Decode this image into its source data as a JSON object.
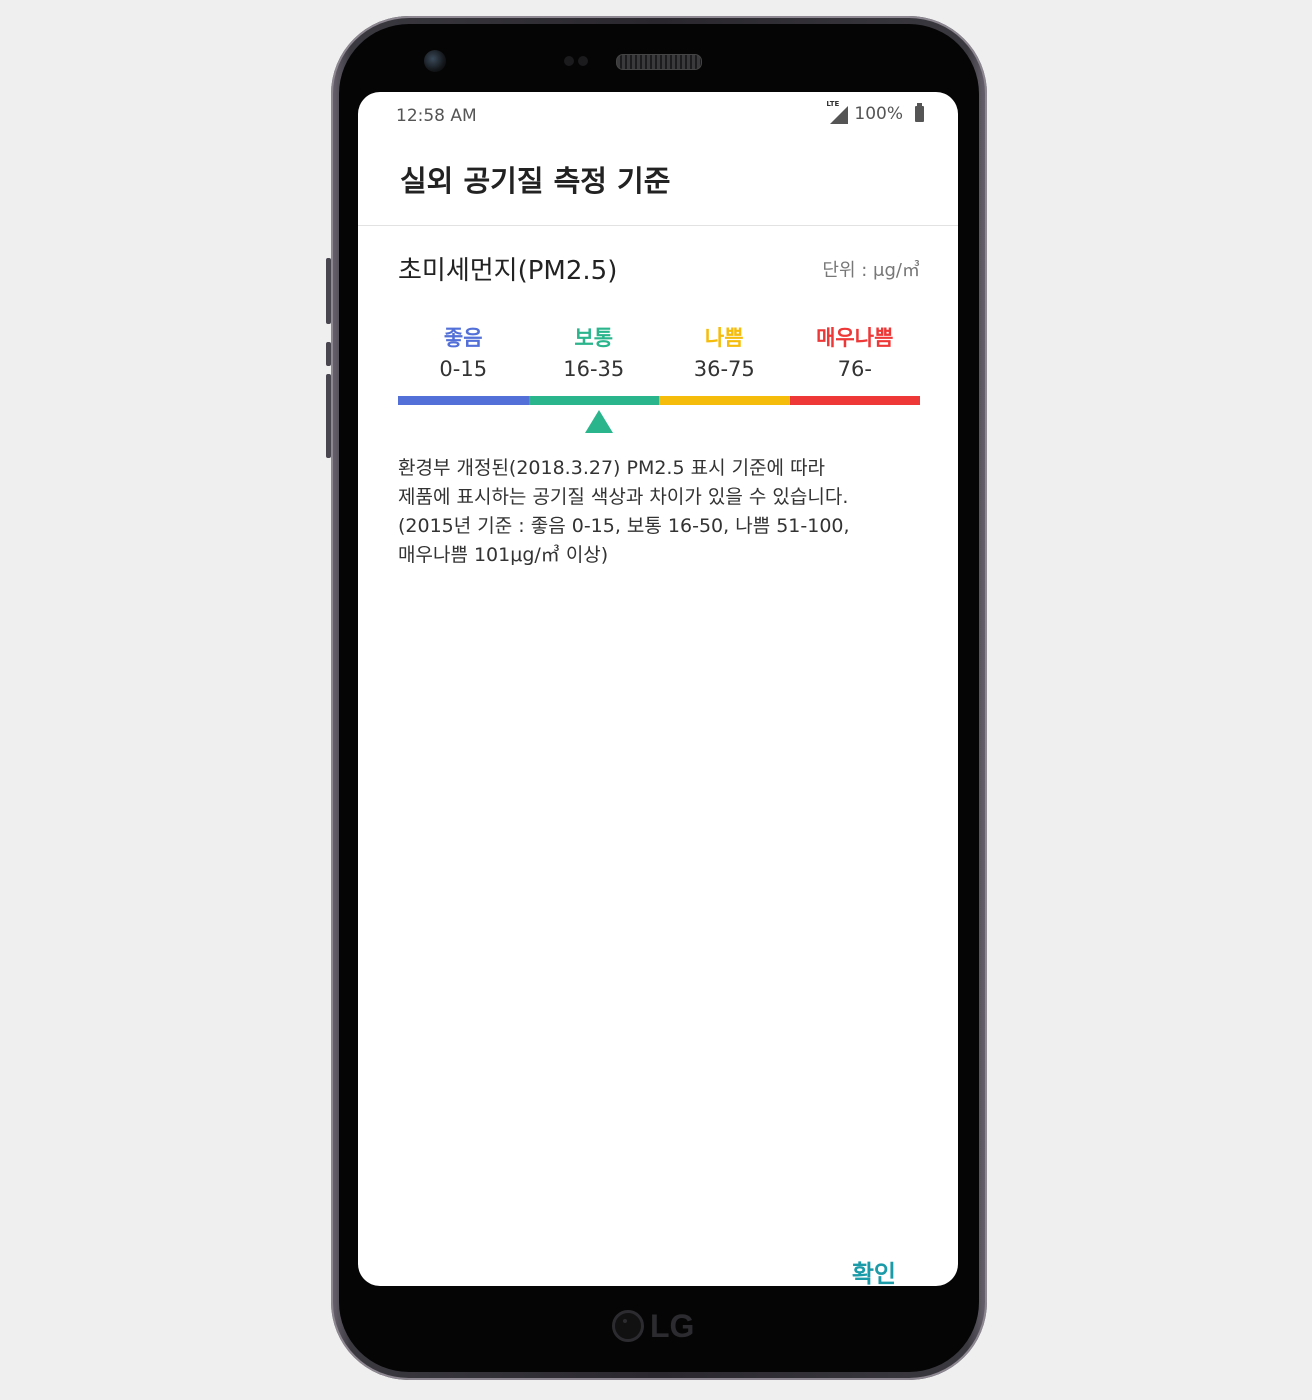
{
  "status_bar": {
    "time": "12:58 AM",
    "network": "LTE",
    "battery": "100%"
  },
  "dialog": {
    "title": "실외 공기질 측정 기준",
    "section_title": "초미세먼지(PM2.5)",
    "unit": "단위 : μg/㎥",
    "levels": [
      {
        "name": "좋음",
        "range": "0-15",
        "color": "#5370d8"
      },
      {
        "name": "보통",
        "range": "16-35",
        "color": "#2bb58c"
      },
      {
        "name": "나쁨",
        "range": "36-75",
        "color": "#f6bc0c"
      },
      {
        "name": "매우나쁨",
        "range": "76-",
        "color": "#ee3838"
      }
    ],
    "current_level_index": 1,
    "note_lines": [
      "환경부 개정된(2018.3.27) PM2.5 표시 기준에 따라",
      "제품에 표시하는 공기질 색상과 차이가 있을 수 있습니다.",
      "(2015년 기준 :  좋음 0-15, 보통 16-50, 나쁨 51-100,",
      "매우나쁨 101μg/㎥ 이상)"
    ],
    "confirm_label": "확인"
  },
  "device": {
    "brand": "LG"
  }
}
